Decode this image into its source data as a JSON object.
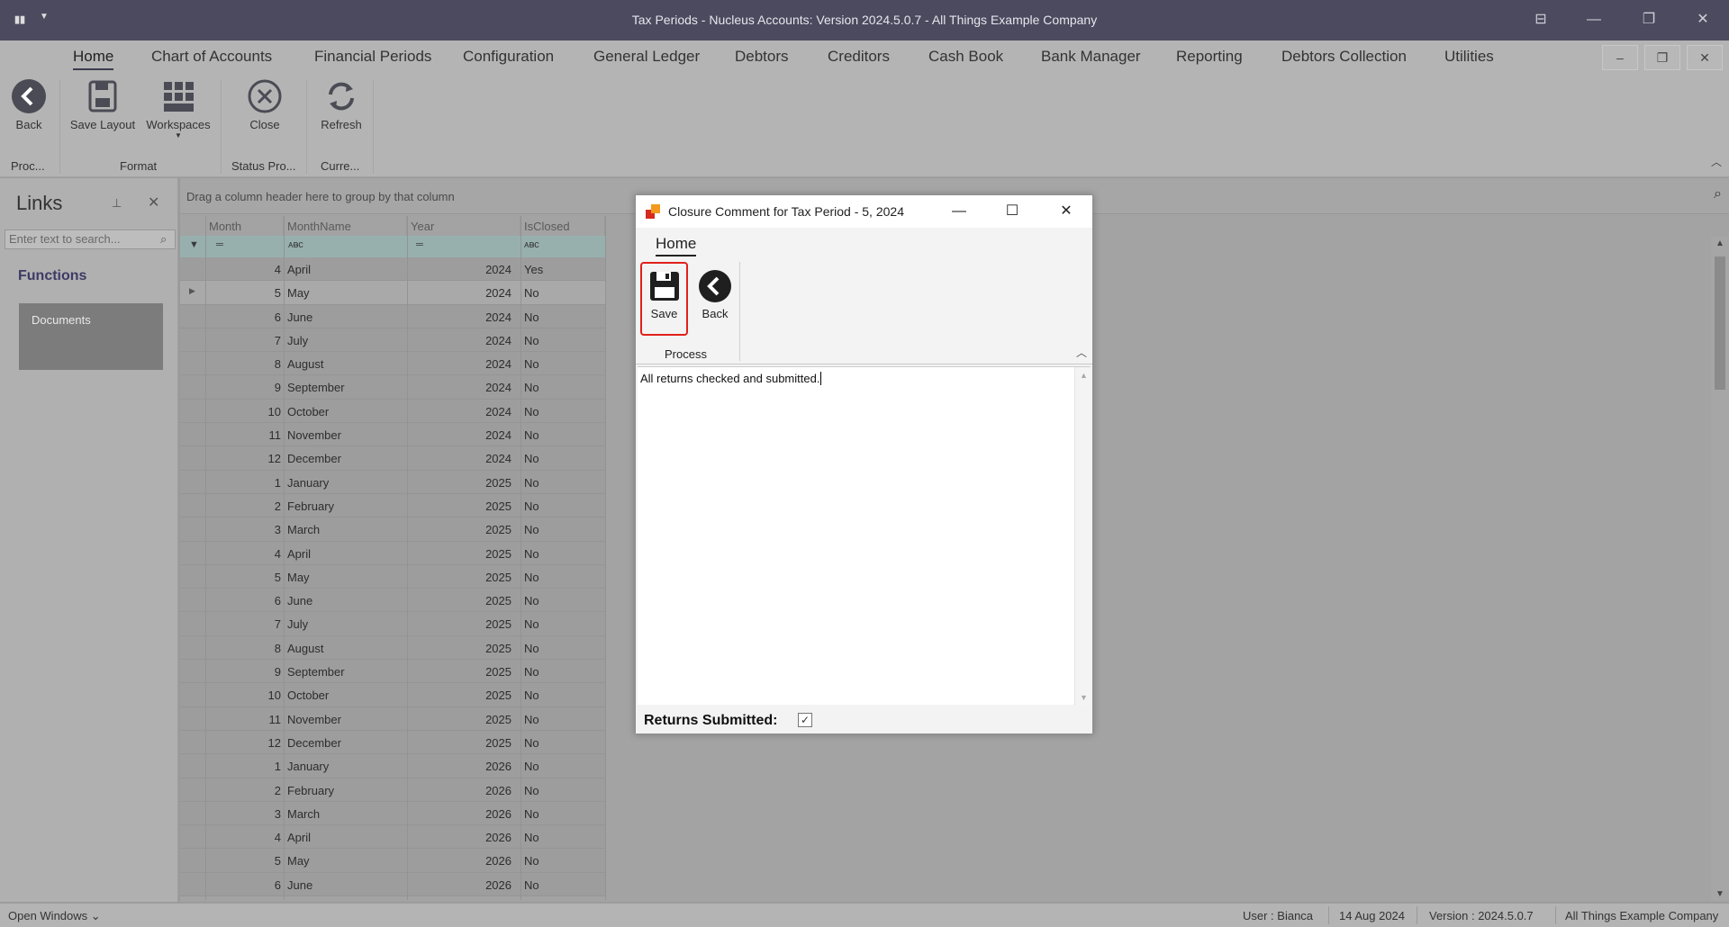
{
  "window": {
    "title": "Tax Periods - Nucleus Accounts: Version 2024.5.0.7 - All Things Example Company"
  },
  "menu": {
    "items": [
      "Home",
      "Chart of Accounts",
      "Financial Periods",
      "Configuration",
      "General Ledger",
      "Debtors",
      "Creditors",
      "Cash Book",
      "Bank Manager",
      "Reporting",
      "Debtors Collection",
      "Utilities"
    ]
  },
  "ribbon": {
    "back": "Back",
    "save_layout": "Save Layout",
    "workspaces": "Workspaces",
    "close": "Close",
    "refresh": "Refresh",
    "groups": {
      "proc": "Proc...",
      "format": "Format",
      "status": "Status Pro...",
      "curre": "Curre..."
    }
  },
  "links": {
    "title": "Links",
    "search_placeholder": "Enter text to search...",
    "functions": "Functions",
    "documents": "Documents"
  },
  "grid": {
    "group_hint": "Drag a column header here to group by that column",
    "columns": [
      "Month",
      "MonthName",
      "Year",
      "IsClosed"
    ],
    "rows": [
      [
        "4",
        "April",
        "2024",
        "Yes"
      ],
      [
        "5",
        "May",
        "2024",
        "No"
      ],
      [
        "6",
        "June",
        "2024",
        "No"
      ],
      [
        "7",
        "July",
        "2024",
        "No"
      ],
      [
        "8",
        "August",
        "2024",
        "No"
      ],
      [
        "9",
        "September",
        "2024",
        "No"
      ],
      [
        "10",
        "October",
        "2024",
        "No"
      ],
      [
        "11",
        "November",
        "2024",
        "No"
      ],
      [
        "12",
        "December",
        "2024",
        "No"
      ],
      [
        "1",
        "January",
        "2025",
        "No"
      ],
      [
        "2",
        "February",
        "2025",
        "No"
      ],
      [
        "3",
        "March",
        "2025",
        "No"
      ],
      [
        "4",
        "April",
        "2025",
        "No"
      ],
      [
        "5",
        "May",
        "2025",
        "No"
      ],
      [
        "6",
        "June",
        "2025",
        "No"
      ],
      [
        "7",
        "July",
        "2025",
        "No"
      ],
      [
        "8",
        "August",
        "2025",
        "No"
      ],
      [
        "9",
        "September",
        "2025",
        "No"
      ],
      [
        "10",
        "October",
        "2025",
        "No"
      ],
      [
        "11",
        "November",
        "2025",
        "No"
      ],
      [
        "12",
        "December",
        "2025",
        "No"
      ],
      [
        "1",
        "January",
        "2026",
        "No"
      ],
      [
        "2",
        "February",
        "2026",
        "No"
      ],
      [
        "3",
        "March",
        "2026",
        "No"
      ],
      [
        "4",
        "April",
        "2026",
        "No"
      ],
      [
        "5",
        "May",
        "2026",
        "No"
      ],
      [
        "6",
        "June",
        "2026",
        "No"
      ]
    ],
    "focused_row": 1
  },
  "dialog": {
    "title": "Closure Comment for Tax Period - 5, 2024",
    "tab": "Home",
    "save": "Save",
    "back": "Back",
    "group": "Process",
    "comment": "All returns checked and submitted.",
    "returns_label": "Returns Submitted:",
    "returns_checked": true
  },
  "status": {
    "open_windows": "Open Windows",
    "user": "User : Bianca",
    "date": "14 Aug 2024",
    "version": "Version : 2024.5.0.7",
    "company": "All Things Example Company"
  },
  "colors": {
    "accent": "#4b4a5e",
    "highlight": "#e1201a"
  }
}
